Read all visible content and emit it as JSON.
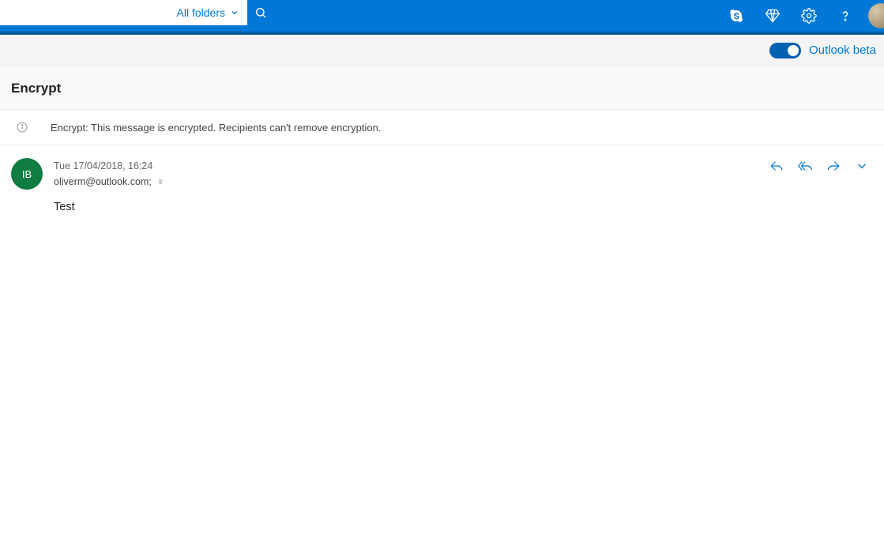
{
  "header": {
    "search_placeholder": "",
    "folder_scope": "All folders"
  },
  "beta": {
    "label": "Outlook beta",
    "enabled": true
  },
  "page": {
    "title": "Encrypt"
  },
  "info": {
    "text": "Encrypt: This message is encrypted. Recipients can't remove encryption."
  },
  "message": {
    "sender_initials": "IB",
    "timestamp": "Tue 17/04/2018, 16:24",
    "recipient": "oliverm@outlook.com;",
    "body": "Test"
  }
}
